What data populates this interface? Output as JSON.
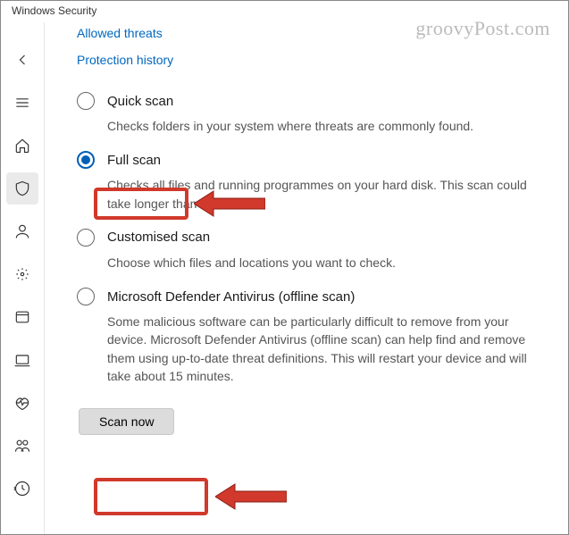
{
  "window": {
    "title": "Windows Security"
  },
  "watermark": "groovyPost.com",
  "links": {
    "allowed_threats": "Allowed threats",
    "protection_history": "Protection history"
  },
  "sidebar": {
    "items": [
      {
        "name": "back"
      },
      {
        "name": "menu"
      },
      {
        "name": "home"
      },
      {
        "name": "shield",
        "active": true
      },
      {
        "name": "account"
      },
      {
        "name": "firewall"
      },
      {
        "name": "app-browser"
      },
      {
        "name": "device-security"
      },
      {
        "name": "performance"
      },
      {
        "name": "family"
      },
      {
        "name": "history"
      }
    ]
  },
  "options": {
    "quick": {
      "label": "Quick scan",
      "desc": "Checks folders in your system where threats are commonly found.",
      "selected": false
    },
    "full": {
      "label": "Full scan",
      "desc": "Checks all files and running programmes on your hard disk. This scan could take longer than one hour.",
      "selected": true
    },
    "custom": {
      "label": "Customised scan",
      "desc": "Choose which files and locations you want to check.",
      "selected": false
    },
    "offline": {
      "label": "Microsoft Defender Antivirus (offline scan)",
      "desc": "Some malicious software can be particularly difficult to remove from your device. Microsoft Defender Antivirus (offline scan) can help find and remove them using up-to-date threat definitions. This will restart your device and will take about 15 minutes.",
      "selected": false
    }
  },
  "button": {
    "scan_now": "Scan now"
  },
  "annotations": {
    "highlight_color": "#d0392b"
  }
}
